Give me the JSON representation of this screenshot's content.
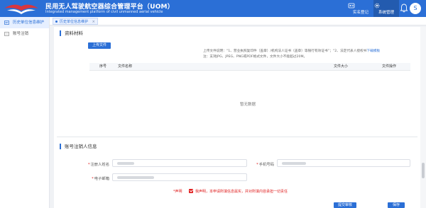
{
  "header": {
    "title_zh": "民用无人驾驶航空器综合管理平台（UOM）",
    "title_en": "Integrated management platform of civil unmanned aerial vehicle",
    "nav": [
      {
        "label": "实名登记",
        "icon": "id-card-icon"
      },
      {
        "label": "系统管理",
        "icon": "settings-icon"
      }
    ],
    "avatar_text": "S"
  },
  "sidebar": {
    "items": [
      {
        "label": "历史单位信息维护",
        "active": true
      },
      {
        "label": "账号注销",
        "active": false
      }
    ]
  },
  "tabs": [
    {
      "label": "历史单位信息维护",
      "close": "×"
    }
  ],
  "materials": {
    "section_title": "资料材料",
    "upload_label": "上传文件",
    "hint_line1": "上传文件说明：“1、营业执照复印件（盖章）/机构法人证书（盖章）等银行有效证书”；“2、法定代表人授权书",
    "hint_link": "下载模板",
    "hint_line2": "注：支持JPG、JPEG、PNG或PDF格式文件，文件大小不能超过20M。",
    "columns": [
      "序号",
      "文件名称",
      "文件大小",
      "文件操作"
    ],
    "empty_text": "暂无数据"
  },
  "registrant": {
    "section_title": "账号注销人信息",
    "name_label": "注册人姓名",
    "phone_label": "手机号码",
    "email_label": "电子邮箱",
    "star": "*"
  },
  "declaration": {
    "label": "*声明",
    "text": "我声明，本申请所填信息属实，并对所填内容承担一切责任",
    "checked": true
  },
  "actions": {
    "submit_label": "提交审核",
    "save_label": "保存"
  },
  "colors": {
    "primary": "#2b6fd6",
    "danger": "#e02020"
  }
}
